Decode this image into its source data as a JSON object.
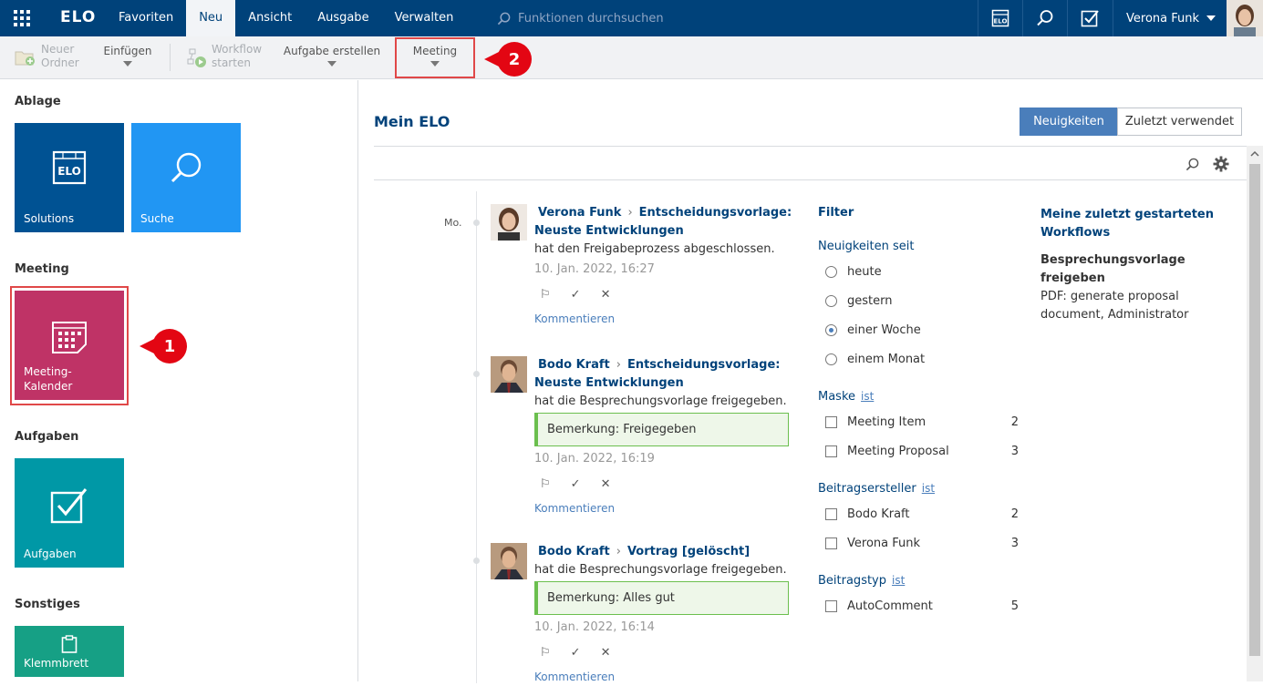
{
  "topbar": {
    "logo": "ELO",
    "menu": [
      {
        "label": "Favoriten",
        "active": false
      },
      {
        "label": "Neu",
        "active": true
      },
      {
        "label": "Ansicht",
        "active": false
      },
      {
        "label": "Ausgabe",
        "active": false
      },
      {
        "label": "Verwalten",
        "active": false
      }
    ],
    "search_placeholder": "Funktionen durchsuchen",
    "user_name": "Verona Funk"
  },
  "toolbar": {
    "new_folder_line1": "Neuer",
    "new_folder_line2": "Ordner",
    "insert": "Einfügen",
    "workflow_line1": "Workflow",
    "workflow_line2": "starten",
    "create_task": "Aufgabe erstellen",
    "meeting": "Meeting"
  },
  "callouts": {
    "one": "1",
    "two": "2"
  },
  "sidebar": {
    "ablage": "Ablage",
    "solutions": "Solutions",
    "suche": "Suche",
    "meeting": "Meeting",
    "meeting_tile_line1": "Meeting-",
    "meeting_tile_line2": "Kalender",
    "aufgaben": "Aufgaben",
    "aufgaben_tile": "Aufgaben",
    "sonstiges": "Sonstiges",
    "klemmbrett": "Klemmbrett"
  },
  "main": {
    "title": "Mein ELO",
    "tab_news": "Neuigkeiten",
    "tab_recent": "Zuletzt verwendet",
    "day_label": "Mo."
  },
  "feed": [
    {
      "author": "Verona Funk",
      "target": "Entscheidungsvorlage:",
      "target2": "Neuste Entwicklungen",
      "action": "hat den Freigabeprozess abgeschlossen.",
      "note": "",
      "time": "10. Jan. 2022, 16:27",
      "comment": "Kommentieren"
    },
    {
      "author": "Bodo Kraft",
      "target": "Entscheidungsvorlage:",
      "target2": "Neuste Entwicklungen",
      "action": "hat die Besprechungsvorlage freigegeben.",
      "note": "Bemerkung: Freigegeben",
      "time": "10. Jan. 2022, 16:19",
      "comment": "Kommentieren"
    },
    {
      "author": "Bodo Kraft",
      "target": "Vortrag [gelöscht]",
      "target2": "",
      "action": "hat die Besprechungsvorlage freigegeben.",
      "note": "Bemerkung: Alles gut",
      "time": "10. Jan. 2022, 16:14",
      "comment": "Kommentieren"
    }
  ],
  "filter": {
    "title": "Filter",
    "since_label": "Neuigkeiten seit",
    "since_options": [
      {
        "label": "heute",
        "selected": false
      },
      {
        "label": "gestern",
        "selected": false
      },
      {
        "label": "einer Woche",
        "selected": true
      },
      {
        "label": "einem Monat",
        "selected": false
      }
    ],
    "mask_label": "Maske",
    "ist": "ist",
    "masks": [
      {
        "label": "Meeting Item",
        "count": "2"
      },
      {
        "label": "Meeting Proposal",
        "count": "3"
      }
    ],
    "creator_label": "Beitragsersteller",
    "creators": [
      {
        "label": "Bodo Kraft",
        "count": "2"
      },
      {
        "label": "Verona Funk",
        "count": "3"
      }
    ],
    "type_label": "Beitragstyp",
    "types": [
      {
        "label": "AutoComment",
        "count": "5"
      }
    ]
  },
  "workflows": {
    "title_line1": "Meine zuletzt gestarteten",
    "title_line2": "Workflows",
    "item_title": "Besprechungsvorlage freigeben",
    "item_desc": "PDF: generate proposal document, Administrator"
  },
  "colors": {
    "topbar": "#00427a",
    "tile_solutions": "#005293",
    "tile_suche": "#2196f3",
    "tile_meeting": "#bf3366",
    "tile_aufgaben": "#0098a6",
    "tile_klemmbrett": "#16a085",
    "callout": "#e30613"
  }
}
